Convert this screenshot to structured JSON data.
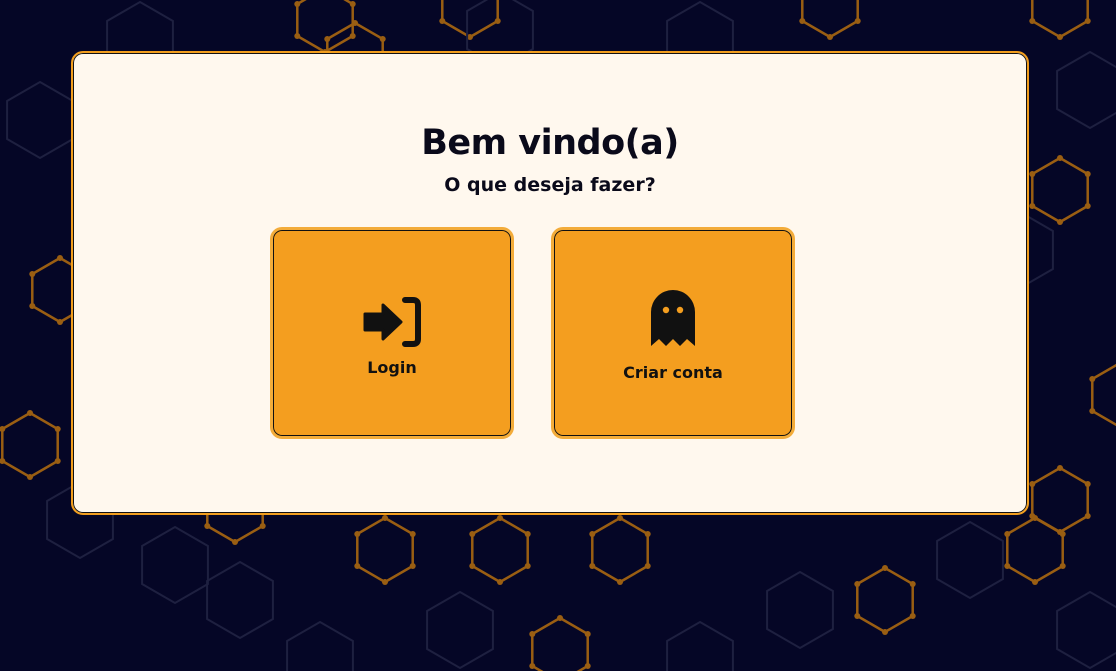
{
  "colors": {
    "background": "#050626",
    "card": "#fff8ee",
    "accent": "#f49e1f",
    "text": "#0a0a1a"
  },
  "welcome": {
    "title": "Bem vindo(a)",
    "subtitle": "O que deseja fazer?"
  },
  "options": [
    {
      "label": "Login",
      "icon": "login-arrow-icon"
    },
    {
      "label": "Criar conta",
      "icon": "ghost-icon"
    }
  ]
}
